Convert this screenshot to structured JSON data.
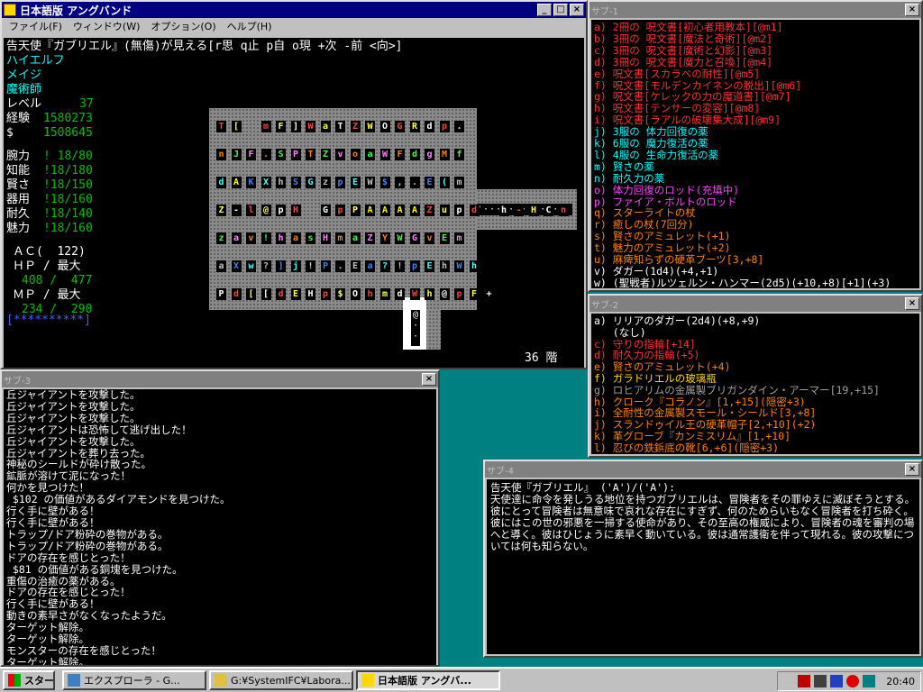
{
  "main": {
    "title": "日本語版 アングバンド",
    "menu": [
      "ファイル(F)",
      "ウィンドウ(W)",
      "オプション(O)",
      "ヘルプ(H)"
    ],
    "target_line": "告天使『ガブリエル』(無傷)が見える[r思 q止 p自 o現 +次 -前 <向>]",
    "race": "ハイエルフ",
    "class": "メイジ",
    "title_rank": "魔術師",
    "level_label": "レベル",
    "level": "37",
    "exp_label": "経験",
    "exp": "1580273",
    "gold_label": "$",
    "gold": "1508645",
    "stats": [
      {
        "label": "腕力",
        "value": "! 18/80"
      },
      {
        "label": "知能",
        "value": "!18/180"
      },
      {
        "label": "賢さ",
        "value": "!18/150"
      },
      {
        "label": "器用",
        "value": "!18/160"
      },
      {
        "label": "耐久",
        "value": "!18/140"
      },
      {
        "label": "魅力",
        "value": "!18/160"
      }
    ],
    "ac_line": "ＡＣ(  122)",
    "hp_label": "ＨＰ / 最大",
    "hp_value": "408 /  477",
    "mp_label": "ＭＰ / 最大",
    "mp_value": "234 /  290",
    "health_bar": "[**********]",
    "depth": "36 階"
  },
  "sub1": {
    "title": "サブ-1",
    "items": [
      {
        "text": "a) 2冊の 呪文書[初心者用教本][@m1]",
        "color": "red"
      },
      {
        "text": "b) 3冊の 呪文書[魔法と奇術][@m2]",
        "color": "red"
      },
      {
        "text": "c) 3冊の 呪文書[魔術と幻影][@m3]",
        "color": "red"
      },
      {
        "text": "d) 3冊の 呪文書[魔力と召喚][@m4]",
        "color": "red"
      },
      {
        "text": "e) 呪文書[スカラベの耐性][@m5]",
        "color": "red"
      },
      {
        "text": "f) 呪文書[モルデンカイネンの脱出][@m6]",
        "color": "red"
      },
      {
        "text": "g) 呪文書[ケレックの力の魔道書][@m7]",
        "color": "red"
      },
      {
        "text": "h) 呪文書[テンサーの変容][@m8]",
        "color": "red"
      },
      {
        "text": "i) 呪文書[ラアルの破壊集大成][@m9]",
        "color": "red"
      },
      {
        "text": "j) 3服の 体力回復の薬",
        "color": "cyan"
      },
      {
        "text": "k) 6服の 魔力復活の薬",
        "color": "cyan"
      },
      {
        "text": "l) 4服の 生命力復活の薬",
        "color": "cyan"
      },
      {
        "text": "m) 賢さの薬",
        "color": "cyan"
      },
      {
        "text": "n) 耐久力の薬",
        "color": "cyan"
      },
      {
        "text": "o) 体力回復のロッド(充填中)",
        "color": "magenta"
      },
      {
        "text": "p) ファイア・ボルトのロッド",
        "color": "magenta"
      },
      {
        "text": "q) スターライトの杖",
        "color": "orange"
      },
      {
        "text": "r) 癒しの杖(7回分)",
        "color": "orange"
      },
      {
        "text": "s) 賢さのアミュレット(+1)",
        "color": "orange"
      },
      {
        "text": "t) 魅力のアミュレット(+2)",
        "color": "orange"
      },
      {
        "text": "u) 麻痺知らずの硬革ブーツ[3,+8]",
        "color": "orange"
      },
      {
        "text": "v) ダガー(1d4)(+4,+1)",
        "color": "white"
      },
      {
        "text": "w) (聖戦者)ルツェルン・ハンマー(2d5)(+10,+8)[+1](+3)",
        "color": "white"
      }
    ]
  },
  "sub2": {
    "title": "サブ-2",
    "items": [
      {
        "text": "a) リリアのダガー(2d4)(+8,+9)",
        "color": "white"
      },
      {
        "text": "   (なし)",
        "color": "white"
      },
      {
        "text": "c) 守りの指輪[+14]",
        "color": "red"
      },
      {
        "text": "d) 耐久力の指輪(+5)",
        "color": "red"
      },
      {
        "text": "e) 賢さのアミュレット(+4)",
        "color": "orange"
      },
      {
        "text": "f) ガラドリエルの玻璃瓶",
        "color": "yellow"
      },
      {
        "text": "g) ロヒアリムの金属製ブリガンダイン・アーマー[19,+15]",
        "color": "gray"
      },
      {
        "text": "h) クローク『コラノン』[1,+15](隠密+3)",
        "color": "orange"
      },
      {
        "text": "i) 全耐性の金属製スモール・シールド[3,+8]",
        "color": "orange"
      },
      {
        "text": "j) スランドゥイル王の硬革帽子[2,+10](+2)",
        "color": "orange"
      },
      {
        "text": "k) 革グローブ『カンミスリム』[1,+10]",
        "color": "orange"
      },
      {
        "text": "l) 忍びの鉄鋲底の靴[6,+6](隠密+3)",
        "color": "orange"
      }
    ]
  },
  "sub3": {
    "title": "サブ-3",
    "lines": [
      "丘ジャイアントを攻撃した。",
      "丘ジャイアントを攻撃した。",
      "丘ジャイアントを攻撃した。",
      "丘ジャイアントは恐怖して逃げ出した！",
      "丘ジャイアントを攻撃した。",
      "丘ジャイアントを葬り去った。",
      "神秘のシールドが砕け散った。",
      "鉱脈が溶けて泥になった！",
      "何かを見つけた！",
      " $102 の価値があるダイアモンドを見つけた。",
      "行く手に壁がある！",
      "行く手に壁がある！",
      "トラップ/ドア粉砕の巻物がある。",
      "トラップ/ドア粉砕の巻物がある。",
      "ドアの存在を感じとった！",
      " $81 の価値がある銅塊を見つけた。",
      "重傷の治癒の薬がある。",
      "ドアの存在を感じとった！",
      "行く手に壁がある！",
      "動きの素早さがなくなったようだ。",
      "ターゲット解除。",
      "ターゲット解除。",
      "モンスターの存在を感じとった！",
      "ターゲット解除。"
    ]
  },
  "sub4": {
    "title": "サブ-4",
    "heading": "告天使『ガブリエル』 ('A')/('A'):",
    "text": "天使達に命令を発しうる地位を持つガブリエルは、冒険者をその罪ゆえに滅ぼそうとする。彼にとって冒険者は無意味で哀れな存在にすぎず、何のためらいもなく冒険者を打ち砕く。彼にはこの世の邪悪を一掃する使命があり、その至高の権威により、冒険者の魂を審判の場へと導く。彼はひじょうに素早く動いている。彼は通常護衛を伴って現れる。彼の攻撃については何も知らない。"
  },
  "taskbar": {
    "start": "スタート",
    "buttons": [
      "エクスプローラ - G...",
      "G:¥SystemIFC¥Labora...",
      "日本語版 アングバ..."
    ],
    "clock": "20:40"
  },
  "map": {
    "rows": [
      "T[ mF]WaTZWOGRdp.",
      "nJF.SPTZvoaWFdgMf",
      "dAKXhSGzpEW$,.E(m",
      "Z-l@pH GpPAAAAZupd h-HCnJ",
      "zav!hasHmaZYWGvEm",
      "aXw?]j!P.Ea?!pEhWh",
      "Pd[[dEHp$OhmdWh@pF+"
    ]
  }
}
